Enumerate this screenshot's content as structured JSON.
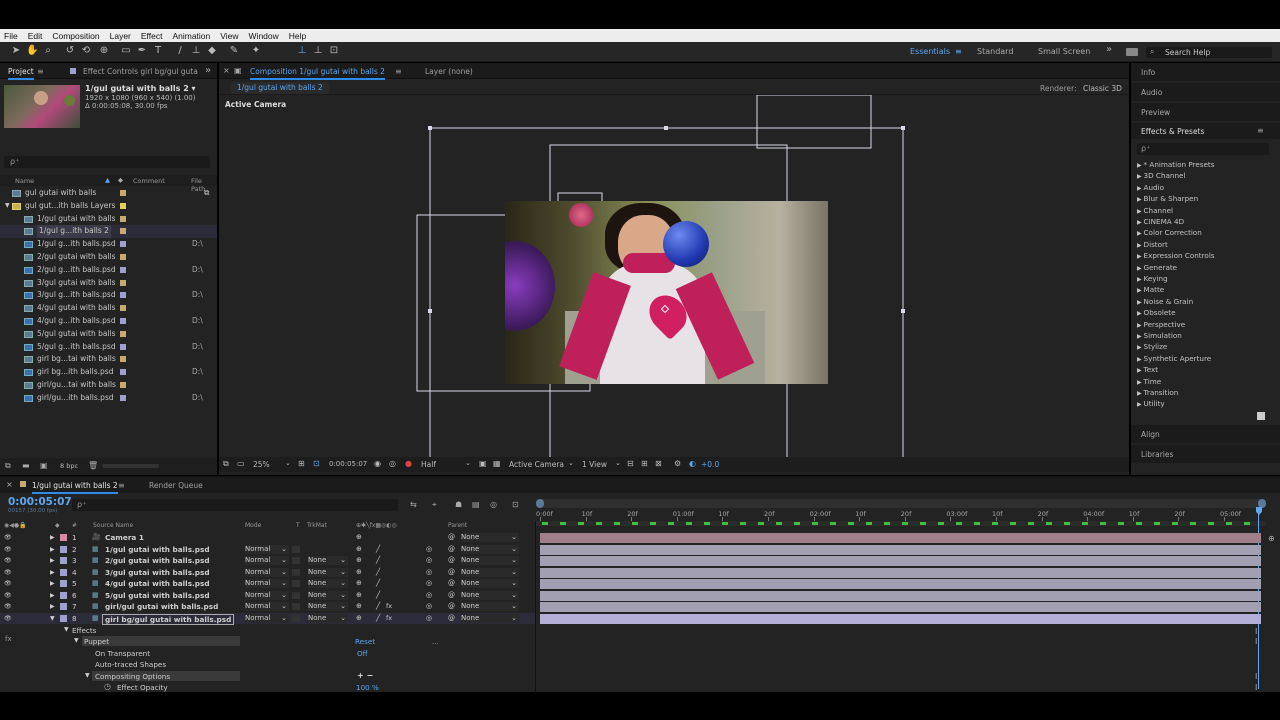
{
  "menu": [
    "File",
    "Edit",
    "Composition",
    "Layer",
    "Effect",
    "Animation",
    "View",
    "Window",
    "Help"
  ],
  "workspaces": {
    "essentials": "Essentials",
    "standard": "Standard",
    "small_screen": "Small Screen",
    "search_help": "Search Help"
  },
  "project_panel": {
    "tab_project": "Project",
    "tab_effect_controls": "Effect Controls girl bg/gul guta",
    "comp_name": "1/gul gutai with balls 2 ▾",
    "comp_info1": "1920 x 1080  (960 x 540) (1.00)",
    "comp_info2": "Δ 0:00:05:08, 30.00 fps",
    "search_placeholder": "ρ⁺",
    "col_name": "Name",
    "col_comment": "Comment",
    "col_filepath": "File Path",
    "items": [
      {
        "name": "gul gutai with balls",
        "path": "",
        "color": "#c8a96e",
        "type": "comp"
      },
      {
        "name": "gul gut...ith balls Layers",
        "path": "",
        "color": "#e0d060",
        "type": "folder"
      },
      {
        "name": "1/gul gutai with balls",
        "path": "",
        "color": "#c8a96e",
        "type": "comp"
      },
      {
        "name": "1/gul g...ith balls 2",
        "path": "",
        "color": "#c8a96e",
        "type": "comp"
      },
      {
        "name": "1/gul g...ith balls.psd",
        "path": "D:\\",
        "color": "#a0a0d0",
        "type": "psd"
      },
      {
        "name": "2/gul gutai with balls",
        "path": "",
        "color": "#c8a96e",
        "type": "comp"
      },
      {
        "name": "2/gul g...ith balls.psd",
        "path": "D:\\",
        "color": "#a0a0d0",
        "type": "psd"
      },
      {
        "name": "3/gul gutai with balls",
        "path": "",
        "color": "#c8a96e",
        "type": "comp"
      },
      {
        "name": "3/gul g...ith balls.psd",
        "path": "D:\\",
        "color": "#a0a0d0",
        "type": "psd"
      },
      {
        "name": "4/gul gutai with balls",
        "path": "",
        "color": "#c8a96e",
        "type": "comp"
      },
      {
        "name": "4/gul g...ith balls.psd",
        "path": "D:\\",
        "color": "#a0a0d0",
        "type": "psd"
      },
      {
        "name": "5/gul gutai with balls",
        "path": "",
        "color": "#c8a96e",
        "type": "comp"
      },
      {
        "name": "5/gul g...ith balls.psd",
        "path": "D:\\",
        "color": "#a0a0d0",
        "type": "psd"
      },
      {
        "name": "girl bg...tai with balls",
        "path": "",
        "color": "#c8a96e",
        "type": "comp"
      },
      {
        "name": "girl bg...ith balls.psd",
        "path": "D:\\",
        "color": "#a0a0d0",
        "type": "psd"
      },
      {
        "name": "girl/gu...tai with balls",
        "path": "",
        "color": "#c8a96e",
        "type": "comp"
      },
      {
        "name": "girl/gu...ith balls.psd",
        "path": "D:\\",
        "color": "#a0a0d0",
        "type": "psd"
      }
    ],
    "bpc": "8 bpc"
  },
  "comp_panel": {
    "tab_comp": "Composition 1/gul gutai with balls 2",
    "tab_layer": "Layer (none)",
    "breadcrumb": "1/gul gutai with balls 2",
    "renderer_label": "Renderer:",
    "renderer": "Classic 3D",
    "active_camera": "Active Camera",
    "zoom": "25%",
    "timecode": "0:00:05:07",
    "resolution": "Half",
    "view": "Active Camera",
    "views": "1 View",
    "exposure": "+0.0"
  },
  "right_panel": {
    "info": "Info",
    "audio": "Audio",
    "preview": "Preview",
    "effects_presets": "Effects & Presets",
    "effects": [
      "* Animation Presets",
      "3D Channel",
      "Audio",
      "Blur & Sharpen",
      "Channel",
      "CINEMA 4D",
      "Color Correction",
      "Distort",
      "Expression Controls",
      "Generate",
      "Keying",
      "Matte",
      "Noise & Grain",
      "Obsolete",
      "Perspective",
      "Simulation",
      "Stylize",
      "Synthetic Aperture",
      "Text",
      "Time",
      "Transition",
      "Utility"
    ],
    "align": "Align",
    "libraries": "Libraries"
  },
  "timeline": {
    "tab_comp": "1/gul gutai with balls 2",
    "tab_render": "Render Queue",
    "timecode": "0:00:05:07",
    "timecode_sub": "00157 (30.00 fps)",
    "col_source": "Source Name",
    "col_mode": "Mode",
    "col_t": "T",
    "col_trkmat": "TrkMat",
    "col_parent": "Parent",
    "ruler": [
      "0:00f",
      "10f",
      "20f",
      "01:00f",
      "10f",
      "20f",
      "02:00f",
      "10f",
      "20f",
      "03:00f",
      "10f",
      "20f",
      "04:00f",
      "10f",
      "20f",
      "05:00f"
    ],
    "layers": [
      {
        "num": "1",
        "name": "Camera 1",
        "mode": "",
        "trkmat": "",
        "parent": "None",
        "color": "#d88aa0",
        "type": "camera"
      },
      {
        "num": "2",
        "name": "1/gul gutai with balls.psd",
        "mode": "Normal",
        "trkmat": "",
        "parent": "None",
        "color": "#a0a0d0",
        "type": "psd"
      },
      {
        "num": "3",
        "name": "2/gul gutai with balls.psd",
        "mode": "Normal",
        "trkmat": "None",
        "parent": "None",
        "color": "#a0a0d0",
        "type": "psd"
      },
      {
        "num": "4",
        "name": "3/gul gutai with balls.psd",
        "mode": "Normal",
        "trkmat": "None",
        "parent": "None",
        "color": "#a0a0d0",
        "type": "psd"
      },
      {
        "num": "5",
        "name": "4/gul gutai with balls.psd",
        "mode": "Normal",
        "trkmat": "None",
        "parent": "None",
        "color": "#a0a0d0",
        "type": "psd"
      },
      {
        "num": "6",
        "name": "5/gul gutai with balls.psd",
        "mode": "Normal",
        "trkmat": "None",
        "parent": "None",
        "color": "#a0a0d0",
        "type": "psd"
      },
      {
        "num": "7",
        "name": "girl/gul gutai with balls.psd",
        "mode": "Normal",
        "trkmat": "None",
        "parent": "None",
        "color": "#a0a0d0",
        "type": "psd"
      },
      {
        "num": "8",
        "name": "girl bg/gul gutai with balls.psd",
        "mode": "Normal",
        "trkmat": "None",
        "parent": "None",
        "color": "#a0a0d0",
        "type": "psd"
      }
    ],
    "effects_label": "Effects",
    "puppet": "Puppet",
    "reset": "Reset",
    "reset_dots": "...",
    "on_transparent": "On Transparent",
    "on_transparent_value": "Off",
    "auto_traced": "Auto-traced Shapes",
    "compositing": "Compositing Options",
    "effect_opacity": "Effect Opacity",
    "effect_opacity_value": "100 %",
    "plus_minus": "+ −"
  }
}
